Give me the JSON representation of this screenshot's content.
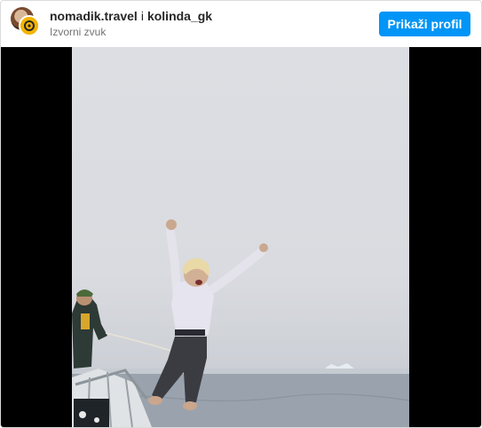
{
  "header": {
    "account_1": "nomadik.travel",
    "separator": "i",
    "account_2": "kolinda_gk",
    "audio": "Izvorni zvuk",
    "profile_button": "Prikaži profil"
  },
  "icons": {
    "avatar": "profile-avatar",
    "badge": "audio-badge-icon"
  },
  "colors": {
    "accent": "#0095f6",
    "badge": "#f4b400",
    "border": "#dbdbdb",
    "letterbox": "#000000"
  }
}
